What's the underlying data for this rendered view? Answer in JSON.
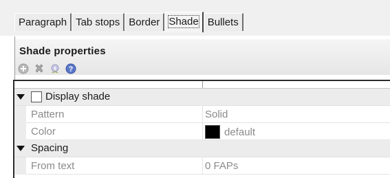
{
  "tabs": [
    {
      "label": "Paragraph",
      "active": false
    },
    {
      "label": "Tab stops",
      "active": false
    },
    {
      "label": "Border",
      "active": false
    },
    {
      "label": "Shade",
      "active": true
    },
    {
      "label": "Bullets",
      "active": false
    }
  ],
  "panel": {
    "title": "Shade properties",
    "toolbar": [
      {
        "icon": "add-icon"
      },
      {
        "icon": "delete-icon"
      },
      {
        "icon": "info-icon"
      },
      {
        "icon": "help-icon"
      }
    ]
  },
  "grid": {
    "rows": [
      {
        "kind": "category",
        "label": "Display shade",
        "checkbox": true,
        "checked": false,
        "expanded": true
      },
      {
        "kind": "property",
        "label": "Pattern",
        "value": "Solid"
      },
      {
        "kind": "property",
        "label": "Color",
        "value": "default",
        "swatch_color": "#000000"
      },
      {
        "kind": "category",
        "label": "Spacing",
        "checkbox": false,
        "expanded": true
      },
      {
        "kind": "property",
        "label": "From text",
        "value": "0 FAPs"
      }
    ]
  },
  "colors": {
    "tab_bg": "#ececec",
    "header_bg": "#eaeaea",
    "category_bg": "#ececec",
    "muted_text": "#8a8a8a"
  }
}
